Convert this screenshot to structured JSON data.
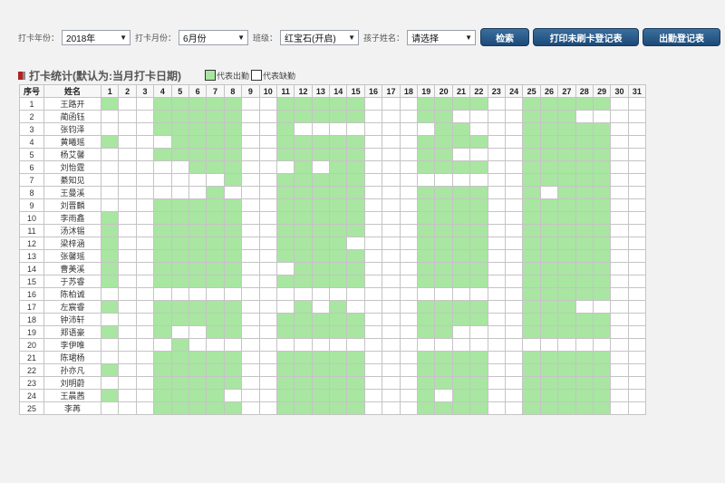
{
  "filters": {
    "year_label": "打卡年份：",
    "year_value": "2018年",
    "month_label": "打卡月份：",
    "month_value": "6月份",
    "class_label": "班级：",
    "class_value": "红宝石(开启)",
    "child_label": "孩子姓名：",
    "child_value": "请选择"
  },
  "buttons": {
    "search": "检索",
    "print_missing": "打印未刷卡登记表",
    "attendance_register": "出勤登记表"
  },
  "section": {
    "title": "打卡统计(默认为:当月打卡日期)",
    "legend_present": "代表出勤",
    "legend_absent": "代表缺勤"
  },
  "colors": {
    "present": "#a8e6a1",
    "absent": "#ffffff",
    "marker_red": "#b22222",
    "marker_gray": "#888888",
    "button_bg": "#1f4e7a"
  },
  "table": {
    "seq_header": "序号",
    "name_header": "姓名",
    "days": [
      "1",
      "2",
      "3",
      "4",
      "5",
      "6",
      "7",
      "8",
      "9",
      "10",
      "11",
      "12",
      "13",
      "14",
      "15",
      "16",
      "17",
      "18",
      "19",
      "20",
      "21",
      "22",
      "23",
      "24",
      "25",
      "26",
      "27",
      "28",
      "29",
      "30",
      "31"
    ],
    "rows": [
      {
        "seq": "1",
        "name": "王路开",
        "present": [
          1,
          4,
          5,
          6,
          7,
          8,
          11,
          12,
          13,
          14,
          15,
          19,
          20,
          21,
          22,
          25,
          26,
          27,
          28,
          29
        ]
      },
      {
        "seq": "2",
        "name": "蔺函钰",
        "present": [
          4,
          5,
          6,
          7,
          8,
          11,
          12,
          13,
          14,
          15,
          19,
          20,
          25,
          26,
          27
        ]
      },
      {
        "seq": "3",
        "name": "张钧泽",
        "present": [
          4,
          5,
          6,
          7,
          8,
          11,
          20,
          21,
          25,
          26,
          27,
          28,
          29
        ]
      },
      {
        "seq": "4",
        "name": "黄曦瑶",
        "present": [
          1,
          5,
          6,
          7,
          8,
          11,
          12,
          13,
          14,
          15,
          19,
          20,
          21,
          22,
          25,
          26,
          27,
          28,
          29
        ]
      },
      {
        "seq": "5",
        "name": "杨艾馨",
        "present": [
          4,
          5,
          6,
          7,
          8,
          11,
          12,
          13,
          14,
          15,
          19,
          20,
          25,
          26,
          27,
          28,
          29
        ]
      },
      {
        "seq": "6",
        "name": "刘怡霆",
        "present": [
          6,
          7,
          8,
          12,
          14,
          15,
          19,
          20,
          21,
          22,
          25,
          26,
          27,
          28,
          29
        ]
      },
      {
        "seq": "7",
        "name": "綦知见",
        "present": [
          8,
          11,
          12,
          13,
          14,
          15,
          25,
          26,
          27,
          28,
          29
        ]
      },
      {
        "seq": "8",
        "name": "王曼溪",
        "present": [
          7,
          11,
          12,
          13,
          14,
          15,
          19,
          20,
          21,
          22,
          25,
          27,
          28,
          29
        ]
      },
      {
        "seq": "9",
        "name": "刘晋麟",
        "present": [
          4,
          5,
          6,
          7,
          8,
          11,
          12,
          13,
          14,
          15,
          19,
          20,
          21,
          22,
          25,
          26,
          27,
          28,
          29
        ]
      },
      {
        "seq": "10",
        "name": "李雨鑫",
        "present": [
          1,
          4,
          5,
          6,
          7,
          8,
          11,
          12,
          13,
          14,
          15,
          19,
          20,
          21,
          22,
          25,
          26,
          27,
          28,
          29
        ]
      },
      {
        "seq": "11",
        "name": "汤沐锡",
        "present": [
          1,
          4,
          5,
          6,
          7,
          8,
          11,
          12,
          13,
          14,
          15,
          19,
          20,
          21,
          22,
          25,
          26,
          27,
          28,
          29
        ]
      },
      {
        "seq": "12",
        "name": "梁梓涵",
        "present": [
          1,
          4,
          5,
          6,
          7,
          8,
          11,
          12,
          13,
          14,
          19,
          20,
          21,
          22,
          25,
          26,
          27,
          28,
          29
        ]
      },
      {
        "seq": "13",
        "name": "张馨瑶",
        "present": [
          1,
          4,
          5,
          6,
          7,
          8,
          11,
          12,
          13,
          14,
          15,
          19,
          20,
          21,
          22,
          25,
          26,
          27,
          28,
          29
        ]
      },
      {
        "seq": "14",
        "name": "曹美溪",
        "present": [
          1,
          4,
          5,
          6,
          7,
          8,
          12,
          13,
          14,
          15,
          19,
          20,
          21,
          22,
          25,
          26,
          27,
          28,
          29
        ]
      },
      {
        "seq": "15",
        "name": "于苏睿",
        "present": [
          1,
          4,
          5,
          6,
          7,
          8,
          11,
          12,
          13,
          14,
          15,
          19,
          20,
          21,
          22,
          25,
          26,
          27,
          28,
          29
        ]
      },
      {
        "seq": "16",
        "name": "陈柏诚",
        "present": [
          25,
          26,
          27,
          28,
          29
        ]
      },
      {
        "seq": "17",
        "name": "左宸睿",
        "present": [
          1,
          4,
          5,
          6,
          7,
          8,
          12,
          14,
          19,
          20,
          21,
          22,
          25,
          26,
          27
        ]
      },
      {
        "seq": "18",
        "name": "钟沛轩",
        "present": [
          4,
          5,
          6,
          7,
          8,
          11,
          12,
          13,
          14,
          15,
          19,
          20,
          21,
          22,
          25,
          26,
          27,
          28,
          29
        ]
      },
      {
        "seq": "19",
        "name": "郑语豪",
        "present": [
          1,
          4,
          7,
          8,
          11,
          12,
          13,
          14,
          15,
          19,
          20,
          25,
          26,
          27,
          28,
          29
        ]
      },
      {
        "seq": "20",
        "name": "李伊唯",
        "present": [
          5
        ]
      },
      {
        "seq": "21",
        "name": "陈珺杨",
        "present": [
          4,
          5,
          6,
          7,
          8,
          11,
          12,
          13,
          14,
          15,
          19,
          20,
          21,
          22,
          25,
          26,
          27,
          28,
          29
        ]
      },
      {
        "seq": "22",
        "name": "孙亦凡",
        "present": [
          1,
          4,
          5,
          6,
          7,
          8,
          11,
          12,
          13,
          14,
          15,
          19,
          20,
          21,
          22,
          25,
          26,
          27,
          28,
          29
        ]
      },
      {
        "seq": "23",
        "name": "刘明蔚",
        "present": [
          4,
          5,
          6,
          7,
          8,
          11,
          12,
          13,
          14,
          15,
          19,
          20,
          21,
          22,
          25,
          26,
          27,
          28,
          29
        ]
      },
      {
        "seq": "24",
        "name": "王晨茜",
        "present": [
          1,
          4,
          5,
          6,
          7,
          11,
          12,
          13,
          14,
          15,
          19,
          21,
          22,
          25,
          26,
          27,
          28,
          29
        ]
      },
      {
        "seq": "25",
        "name": "李苒",
        "present": [
          4,
          5,
          6,
          7,
          8,
          11,
          12,
          13,
          14,
          15,
          19,
          20,
          21,
          22,
          25,
          26,
          27,
          28,
          29
        ]
      }
    ]
  }
}
